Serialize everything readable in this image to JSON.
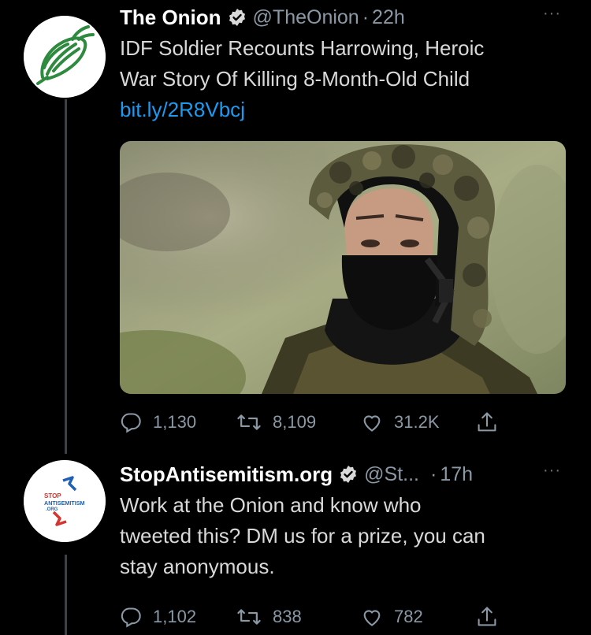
{
  "tweets": [
    {
      "name": "The Onion",
      "handle": "@TheOnion",
      "dot": "·",
      "time": "22h",
      "more": "···",
      "text_lines": [
        "IDF Soldier Recounts Harrowing, Heroic",
        "War Story Of Killing 8-Month-Old Child"
      ],
      "link": "bit.ly/2R8Vbcj",
      "stats": {
        "replies": "1,130",
        "retweets": "8,109",
        "likes": "31.2K"
      },
      "avatar_icon": "onion-logo-icon"
    },
    {
      "name": "StopAntisemitism.org",
      "handle": "@St...",
      "dot": "·",
      "time": "17h",
      "more": "···",
      "text_lines": [
        "Work at the Onion and know who",
        "tweeted this? DM us for a prize, you can",
        "stay anonymous."
      ],
      "stats": {
        "replies": "1,102",
        "retweets": "838",
        "likes": "782"
      },
      "avatar_logo": {
        "line1": "STOP",
        "line2": "ANTISEMITISM",
        "line3": ".ORG"
      }
    }
  ],
  "colors": {
    "background": "#000000",
    "link": "#1d9bf0",
    "muted": "#8b98a5",
    "onion_green": "#2d8a3e"
  }
}
